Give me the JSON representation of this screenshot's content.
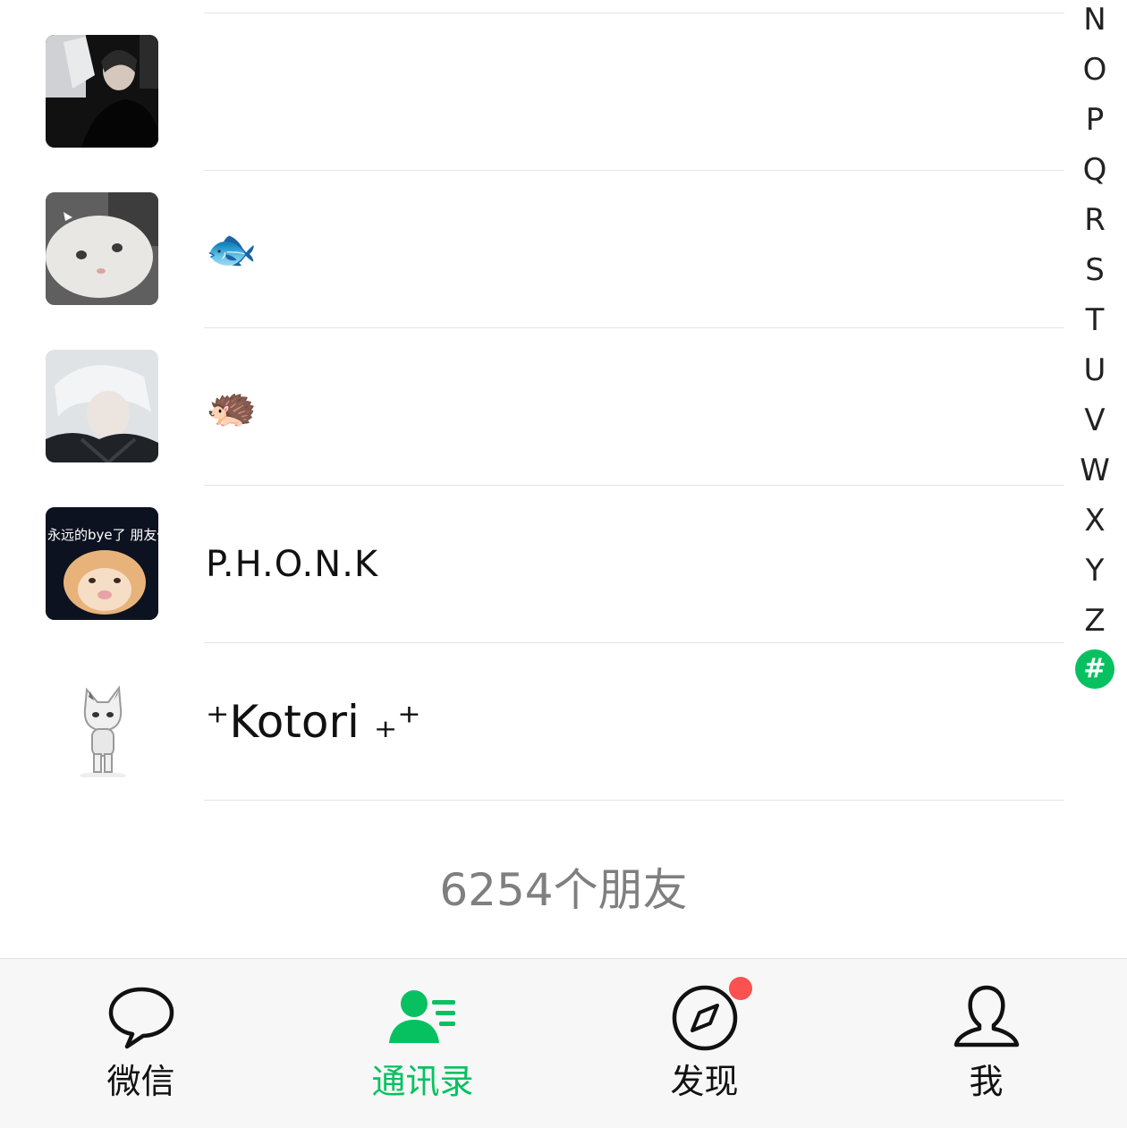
{
  "contacts": [
    {
      "name": "",
      "avatar": "person-photo-avatar"
    },
    {
      "name": "🐟",
      "avatar": "white-cat-avatar"
    },
    {
      "name": "🦔",
      "avatar": "white-hair-anime-avatar"
    },
    {
      "name": "P.H.O.N.K",
      "avatar": "cat-meme-avatar",
      "avatar_text": "永远的bye了 朋友们"
    },
    {
      "name": "⁺Kotori ₊⁺",
      "avatar": "cartoon-cat-avatar"
    }
  ],
  "index_letters": [
    "N",
    "O",
    "P",
    "Q",
    "R",
    "S",
    "T",
    "U",
    "V",
    "W",
    "X",
    "Y",
    "Z",
    "#"
  ],
  "active_index": "#",
  "friend_count": "6254个朋友",
  "tabs": [
    {
      "label": "微信",
      "icon": "chat-bubble-icon"
    },
    {
      "label": "通讯录",
      "icon": "contacts-icon"
    },
    {
      "label": "发现",
      "icon": "compass-icon"
    },
    {
      "label": "我",
      "icon": "person-icon"
    }
  ],
  "colors": {
    "accent": "#07c160",
    "badge": "#fa5151",
    "count_text": "#7f7f7f"
  }
}
